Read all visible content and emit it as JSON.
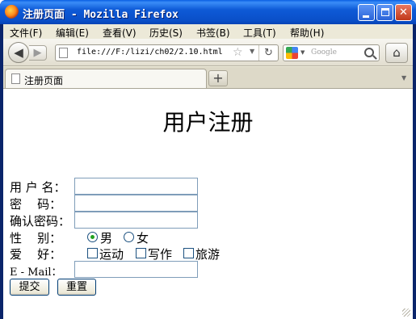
{
  "window": {
    "title": "注册页面 - Mozilla Firefox",
    "minimize": "▁",
    "maximize": "□",
    "close": "✕"
  },
  "menubar": {
    "items": [
      {
        "label": "文件(F)"
      },
      {
        "label": "编辑(E)"
      },
      {
        "label": "查看(V)"
      },
      {
        "label": "历史(S)"
      },
      {
        "label": "书签(B)"
      },
      {
        "label": "工具(T)"
      },
      {
        "label": "帮助(H)"
      }
    ]
  },
  "navbar": {
    "back_icon": "arrow-left-icon",
    "forward_icon": "arrow-right-icon",
    "url": "file:///F:/lizi/ch02/2.10.html",
    "search_engine": "google-icon",
    "search_placeholder": "Google",
    "home_icon": "home-icon"
  },
  "tabs": [
    {
      "label": "注册页面",
      "active": true
    }
  ],
  "page": {
    "heading": "用户注册",
    "fields": {
      "username_label": "用 户 名：",
      "password_label": "密    码：",
      "confirm_label": "确认密码：",
      "gender_label": "性    别：",
      "hobby_label": "爱    好：",
      "email_label": "E - Mail："
    },
    "gender_options": [
      {
        "label": "男",
        "checked": true
      },
      {
        "label": "女",
        "checked": false
      }
    ],
    "hobby_options": [
      {
        "label": "运动",
        "checked": false
      },
      {
        "label": "写作",
        "checked": false
      },
      {
        "label": "旅游",
        "checked": false
      }
    ],
    "buttons": {
      "submit": "提交",
      "reset": "重置"
    }
  },
  "colors": {
    "titlebar": "#0a4fc8",
    "chrome": "#ece9d8",
    "radio_checked": "#21a121"
  }
}
